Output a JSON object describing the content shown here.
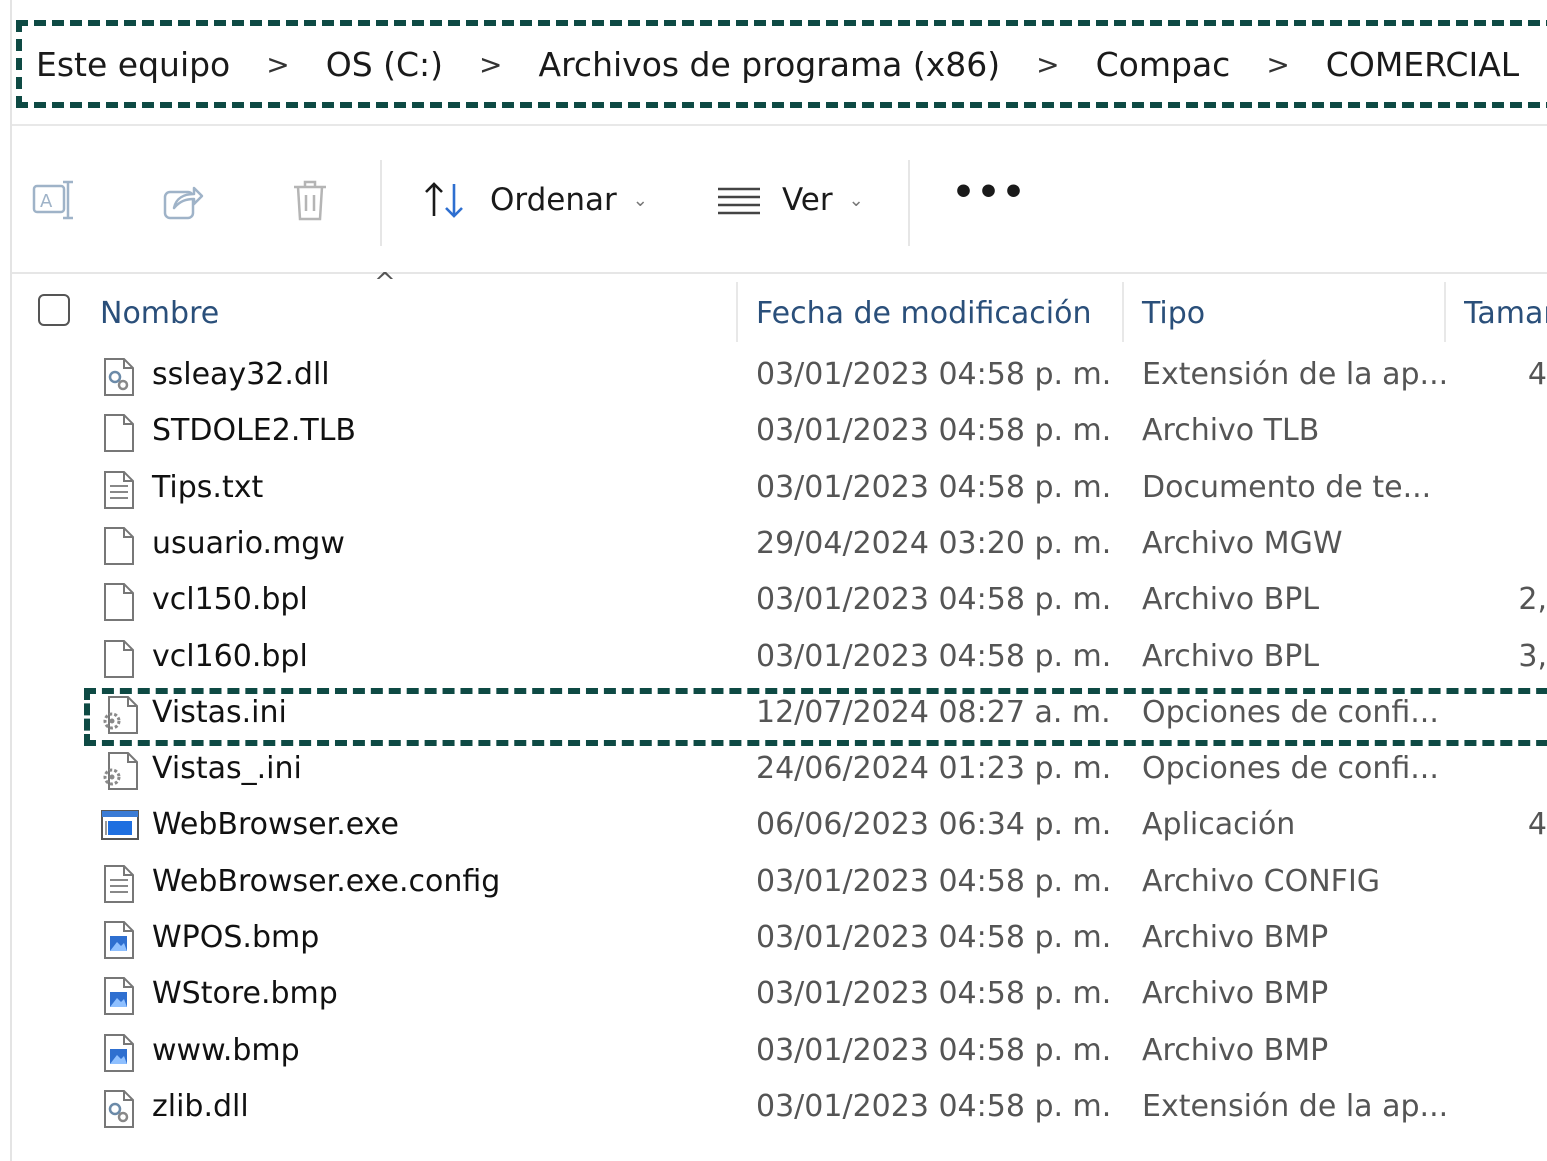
{
  "breadcrumb": [
    "Este equipo",
    "OS (C:)",
    "Archivos de programa (x86)",
    "Compac",
    "COMERCIAL"
  ],
  "breadcrumb_separator": ">",
  "toolbar": {
    "sort_label": "Ordenar",
    "view_label": "Ver",
    "more_label": "•••"
  },
  "columns": {
    "name": "Nombre",
    "date": "Fecha de modificación",
    "type": "Tipo",
    "size": "Tamaño"
  },
  "files": [
    {
      "name": "ssleay32.dll",
      "date": "03/01/2023 04:58 p. m.",
      "type": "Extensión de la ap...",
      "size": "4",
      "icon": "dll-file-icon"
    },
    {
      "name": "STDOLE2.TLB",
      "date": "03/01/2023 04:58 p. m.",
      "type": "Archivo TLB",
      "size": "",
      "icon": "blank-file-icon"
    },
    {
      "name": "Tips.txt",
      "date": "03/01/2023 04:58 p. m.",
      "type": "Documento de te...",
      "size": "",
      "icon": "text-file-icon"
    },
    {
      "name": "usuario.mgw",
      "date": "29/04/2024 03:20 p. m.",
      "type": "Archivo MGW",
      "size": "",
      "icon": "blank-file-icon"
    },
    {
      "name": "vcl150.bpl",
      "date": "03/01/2023 04:58 p. m.",
      "type": "Archivo BPL",
      "size": "2,",
      "icon": "blank-file-icon"
    },
    {
      "name": "vcl160.bpl",
      "date": "03/01/2023 04:58 p. m.",
      "type": "Archivo BPL",
      "size": "3,",
      "icon": "blank-file-icon"
    },
    {
      "name": "Vistas.ini",
      "date": "12/07/2024 08:27 a. m.",
      "type": "Opciones de confi...",
      "size": "",
      "icon": "settings-file-icon"
    },
    {
      "name": "Vistas_.ini",
      "date": "24/06/2024 01:23 p. m.",
      "type": "Opciones de confi...",
      "size": "",
      "icon": "settings-file-icon"
    },
    {
      "name": "WebBrowser.exe",
      "date": "06/06/2023 06:34 p. m.",
      "type": "Aplicación",
      "size": "4",
      "icon": "exe-file-icon"
    },
    {
      "name": "WebBrowser.exe.config",
      "date": "03/01/2023 04:58 p. m.",
      "type": "Archivo CONFIG",
      "size": "",
      "icon": "text-file-icon"
    },
    {
      "name": "WPOS.bmp",
      "date": "03/01/2023 04:58 p. m.",
      "type": "Archivo BMP",
      "size": "",
      "icon": "image-file-icon"
    },
    {
      "name": "WStore.bmp",
      "date": "03/01/2023 04:58 p. m.",
      "type": "Archivo BMP",
      "size": "",
      "icon": "image-file-icon"
    },
    {
      "name": "www.bmp",
      "date": "03/01/2023 04:58 p. m.",
      "type": "Archivo BMP",
      "size": "",
      "icon": "image-file-icon"
    },
    {
      "name": "zlib.dll",
      "date": "03/01/2023 04:58 p. m.",
      "type": "Extensión de la ap...",
      "size": "",
      "icon": "dll-file-icon"
    }
  ],
  "highlighted_file": "Vistas.ini",
  "colors": {
    "highlight_frame": "#0e4a44",
    "header_text": "#2a4f7a",
    "secondary_text": "#555555"
  }
}
